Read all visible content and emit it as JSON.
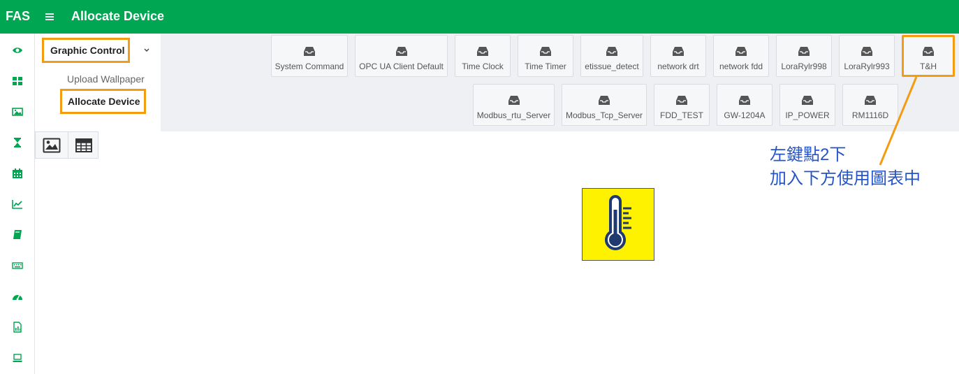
{
  "header": {
    "brand": "FAS",
    "title": "Allocate Device"
  },
  "rail": {
    "icons": [
      "eye-icon",
      "dashboard-icon",
      "image-icon",
      "hourglass-icon",
      "calendar-icon",
      "line-chart-icon",
      "book-icon",
      "keyboard-icon",
      "gauge-icon",
      "file-chart-icon",
      "laptop-icon"
    ],
    "active_color": "#00a651"
  },
  "submenu": {
    "group_label": "Graphic Control",
    "items": [
      "Upload Wallpaper",
      "Allocate Device"
    ],
    "active_item": "Allocate Device"
  },
  "devices": {
    "row1": [
      "System Command",
      "OPC UA Client Default",
      "Time Clock",
      "Time Timer",
      "etissue_detect",
      "network drt",
      "network fdd",
      "LoraRylr998",
      "LoraRylr993",
      "T&H"
    ],
    "row2": [
      "Modbus_rtu_Server",
      "Modbus_Tcp_Server",
      "FDD_TEST",
      "GW-1204A",
      "IP_POWER",
      "RM1116D"
    ],
    "selected": "T&H",
    "icon": "inbox-icon"
  },
  "canvas": {
    "device_icon": "thermometer-icon",
    "device_background": "#fff200"
  },
  "view_toggles": [
    "image-view-icon",
    "table-view-icon"
  ],
  "annotation": {
    "line1": "左鍵點2下",
    "line2": "加入下方使用圖表中",
    "color": "#2454c7",
    "highlight_color": "#f39c12"
  }
}
